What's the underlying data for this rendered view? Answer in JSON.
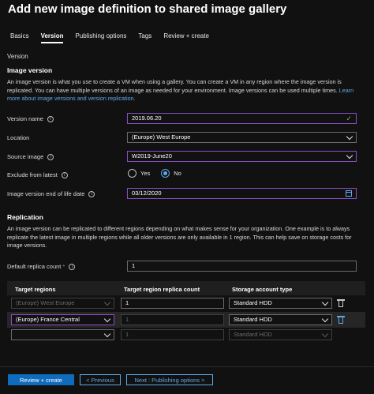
{
  "page": {
    "title": "Add new image definition to shared image gallery"
  },
  "tabs": [
    {
      "label": "Basics",
      "active": false
    },
    {
      "label": "Version",
      "active": true
    },
    {
      "label": "Publishing options",
      "active": false
    },
    {
      "label": "Tags",
      "active": false
    },
    {
      "label": "Review + create",
      "active": false
    }
  ],
  "version_section": {
    "label": "Version",
    "heading": "Image version",
    "description": "An image version is what you use to create a VM when using a gallery. You can create a VM in any region where the image version is replicated. You can have multiple versions of an image as needed for your environment. Image versions can be used multiple times.",
    "learn_more": "Learn more about image versions and version replication."
  },
  "form": {
    "version_name": {
      "label": "Version name",
      "value": "2019.06.20"
    },
    "location": {
      "label": "Location",
      "value": "(Europe) West Europe"
    },
    "source_image": {
      "label": "Source image",
      "value": "W2019-June20"
    },
    "exclude_from_latest": {
      "label": "Exclude from latest",
      "yes": "Yes",
      "no": "No",
      "selected": "No"
    },
    "end_of_life": {
      "label": "Image version end of life date",
      "value": "03/12/2020"
    }
  },
  "replication": {
    "heading": "Replication",
    "description": "An image version can be replicated to different regions depending on what makes sense for your organization. One example is to always replicate the latest image in multiple regions while all older versions are only available in 1 region. This can help save on storage costs for image versions.",
    "default_replica_count": {
      "label": "Default replica count",
      "required_mark": "*",
      "value": "1"
    },
    "table": {
      "headers": [
        "Target regions",
        "Target region replica count",
        "Storage account type"
      ],
      "rows": [
        {
          "region": "(Europe) West Europe",
          "count": "1",
          "storage": "Standard HDD"
        },
        {
          "region": "(Europe) France Central",
          "count": "1",
          "storage": "Standard HDD"
        },
        {
          "region": "",
          "count": "1",
          "storage": "Standard HDD"
        }
      ]
    }
  },
  "footer": {
    "review_create": "Review + create",
    "previous": "< Previous",
    "next": "Next : Publishing options >"
  },
  "colors": {
    "background": "#111111",
    "primary_button": "#0f6cbd",
    "link": "#5fa8e6",
    "focus_border": "#8a4dc8"
  }
}
